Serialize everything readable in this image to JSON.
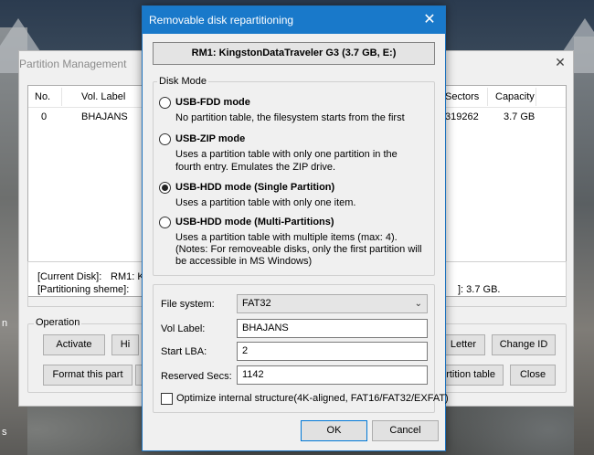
{
  "desktop": {
    "left_chars": [
      "n",
      "s"
    ]
  },
  "bg_window": {
    "title": "Partition Management",
    "columns": [
      "No.",
      "Vol. Label",
      "Sectors",
      "Capacity"
    ],
    "row": {
      "no": "0",
      "label": "BHAJANS",
      "sectors": "319262",
      "capacity": "3.7 GB"
    },
    "current_disk_label": "[Current Disk]:",
    "current_disk_value": "RM1: K",
    "partitioning_label": "[Partitioning sheme]:",
    "partitioning_value": "]: 3.7 GB.",
    "operation_label": "Operation",
    "buttons": {
      "activate": "Activate",
      "hide": "Hi",
      "format": "Format this part",
      "letter": "Letter",
      "change_id": "Change ID",
      "partition_table": "rtition table",
      "close": "Close"
    }
  },
  "dialog": {
    "title": "Removable disk repartitioning",
    "disk": "RM1: KingstonDataTraveler G3 (3.7 GB, E:)",
    "disk_mode_label": "Disk Mode",
    "modes": [
      {
        "label": "USB-FDD mode",
        "desc": [
          "No partition table, the filesystem starts from the first"
        ],
        "checked": false
      },
      {
        "label": "USB-ZIP mode",
        "desc": [
          "Uses a partition table with only one partition in the",
          "fourth entry. Emulates the ZIP drive."
        ],
        "checked": false
      },
      {
        "label": "USB-HDD mode (Single Partition)",
        "desc": [
          "Uses a partition table with only one item."
        ],
        "checked": true
      },
      {
        "label": "USB-HDD mode (Multi-Partitions)",
        "desc": [
          "Uses a partition table with multiple items (max: 4).",
          "(Notes: For removeable disks, only the first partition will",
          "be accessible in MS Windows)"
        ],
        "checked": false
      }
    ],
    "file_system_label": "File system:",
    "file_system_value": "FAT32",
    "vol_label_label": "Vol Label:",
    "vol_label_value": "BHAJANS",
    "start_lba_label": "Start LBA:",
    "start_lba_value": "2",
    "reserved_label": "Reserved Secs:",
    "reserved_value": "1142",
    "optimize_label": "Optimize internal structure(4K-aligned, FAT16/FAT32/EXFAT)",
    "optimize_checked": false,
    "ok": "OK",
    "cancel": "Cancel"
  }
}
